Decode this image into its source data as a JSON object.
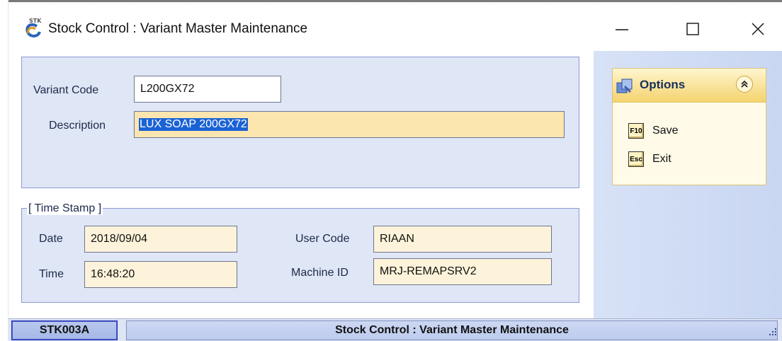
{
  "window": {
    "title": "Stock Control : Variant Master Maintenance"
  },
  "form": {
    "variant_code_label": "Variant Code",
    "variant_code_value": "L200GX72",
    "description_label": "Description",
    "description_value": "LUX SOAP 200GX72"
  },
  "timestamp": {
    "legend": "[ Time Stamp ]",
    "date_label": "Date",
    "date_value": "2018/09/04",
    "time_label": "Time",
    "time_value": "16:48:20",
    "user_code_label": "User Code",
    "user_code_value": "RIAAN",
    "machine_id_label": "Machine ID",
    "machine_id_value": "MRJ-REMAPSRV2"
  },
  "options": {
    "title": "Options",
    "items": [
      {
        "key": "F10",
        "label": "Save"
      },
      {
        "key": "Esc",
        "label": "Exit"
      }
    ]
  },
  "statusbar": {
    "screen_code": "STK003A",
    "screen_title": "Stock Control : Variant Master Maintenance"
  },
  "colors": {
    "panel_blue": "#dfe6f6",
    "selection": "#1b62d4",
    "field_yellow": "#fbe6b0",
    "options_header": "#f4d36e"
  }
}
